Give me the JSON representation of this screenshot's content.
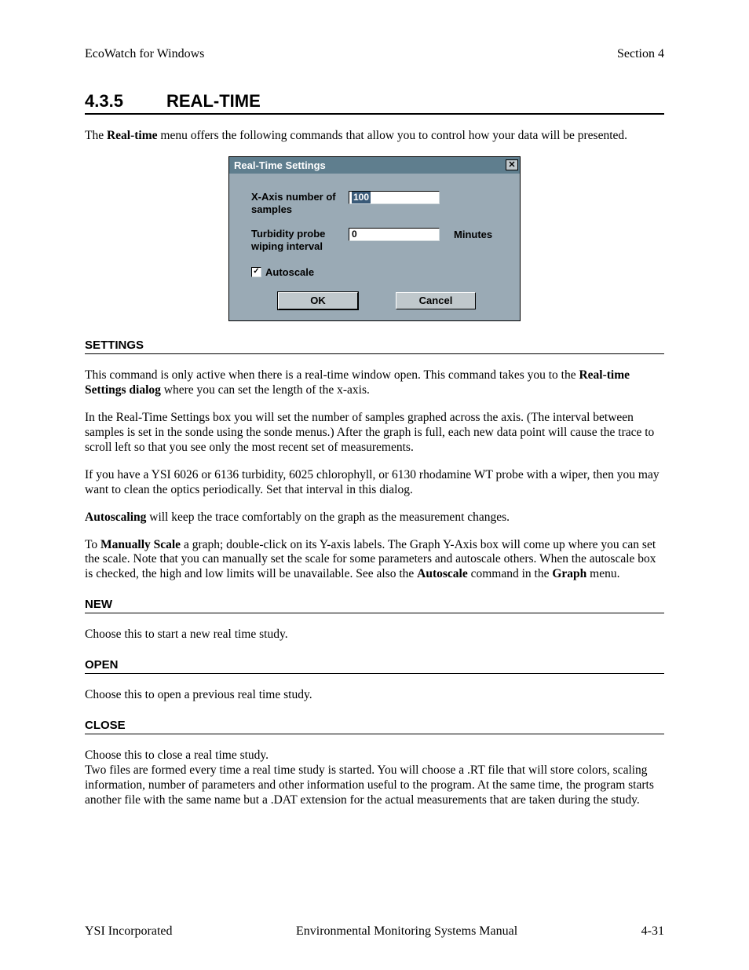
{
  "header": {
    "left": "EcoWatch for Windows",
    "right": "Section 4"
  },
  "main": {
    "section_num": "4.3.5",
    "section_title": "REAL-TIME",
    "intro_pre": "The ",
    "intro_b1": "Real-time",
    "intro_post": " menu offers the following commands that allow you to control how your data will be presented."
  },
  "dialog": {
    "title": "Real-Time Settings",
    "close": "✕",
    "xaxis_label": "X-Axis number of samples",
    "xaxis_value": "100",
    "turb_label": "Turbidity probe wiping interval",
    "turb_value": "0",
    "minutes": "Minutes",
    "check_mark": "✓",
    "autoscale": "Autoscale",
    "ok": "OK",
    "cancel": "Cancel"
  },
  "settings": {
    "head": "SETTINGS",
    "p1a": "This command is only active when there is a real-time window open.  This command takes you to the ",
    "p1b": "Real-time Settings dialog",
    "p1c": "  where you can set the length of the x-axis.",
    "p2": "In the Real-Time Settings box you will set the number of samples graphed across the axis.  (The interval between samples is set in the sonde using the sonde menus.)  After the graph is full, each new data point will cause the trace to scroll left so that you see only the most recent set of measurements.",
    "p3": "If you have a YSI 6026 or 6136 turbidity, 6025 chlorophyll, or 6130 rhodamine WT probe with a wiper, then you may want to clean the optics periodically.  Set that interval in this dialog.",
    "p4b": "Autoscaling",
    "p4c": " will keep the trace comfortably on the graph as the measurement changes.",
    "p5a": "To ",
    "p5b": "Manually Scale",
    "p5c": " a graph; double-click on its Y-axis labels.  The Graph Y-Axis box will come up where you can set the scale.  Note that you can manually set the scale for some parameters and autoscale others.  When the autoscale box is checked, the high and low limits will be unavailable. See also the ",
    "p5d": "Autoscale",
    "p5e": " command in the ",
    "p5f": "Graph",
    "p5g": " menu."
  },
  "new": {
    "head": "NEW",
    "p": "Choose this to start a new real time study."
  },
  "open": {
    "head": "OPEN",
    "p": "Choose this to open a previous real time study."
  },
  "close": {
    "head": "CLOSE",
    "p1": "Choose this to close a real time study.",
    "p2": "Two files are formed every time a real time study is started.  You will choose a .RT file that will store colors, scaling information, number of parameters and other information useful to the program.  At the same time, the program starts another file with the same name but a .DAT extension for the actual measurements that are taken during the study."
  },
  "footer": {
    "left": "YSI Incorporated",
    "mid": "Environmental Monitoring Systems Manual",
    "right": "4-31"
  }
}
